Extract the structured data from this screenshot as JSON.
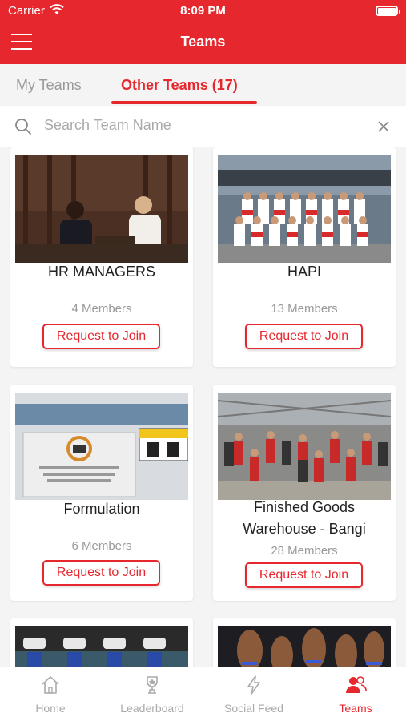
{
  "status_bar": {
    "carrier": "Carrier",
    "time": "8:09 PM"
  },
  "header": {
    "title": "Teams",
    "menu_icon": "hamburger-icon"
  },
  "tabs": [
    {
      "label": "My Teams",
      "active": false
    },
    {
      "label": "Other Teams (17)",
      "active": true
    }
  ],
  "search": {
    "placeholder": "Search Team Name",
    "value": ""
  },
  "teams": [
    {
      "name": "HR MANAGERS",
      "members": "4 Members",
      "button": "Request to Join"
    },
    {
      "name": "HAPI",
      "members": "13 Members",
      "button": "Request to Join"
    },
    {
      "name": "Formulation",
      "members": "6 Members",
      "button": "Request to Join"
    },
    {
      "name": "Finished Goods Warehouse - Bangi",
      "members": "28 Members",
      "button": "Request to Join"
    }
  ],
  "bottom_nav": [
    {
      "label": "Home",
      "icon": "home-icon",
      "active": false
    },
    {
      "label": "Leaderboard",
      "icon": "trophy-icon",
      "active": false
    },
    {
      "label": "Social Feed",
      "icon": "lightning-icon",
      "active": false
    },
    {
      "label": "Teams",
      "icon": "people-icon",
      "active": true
    }
  ],
  "colors": {
    "brand": "#e6282e",
    "inactive": "#aaaaaa",
    "background": "#f4f4f4"
  }
}
